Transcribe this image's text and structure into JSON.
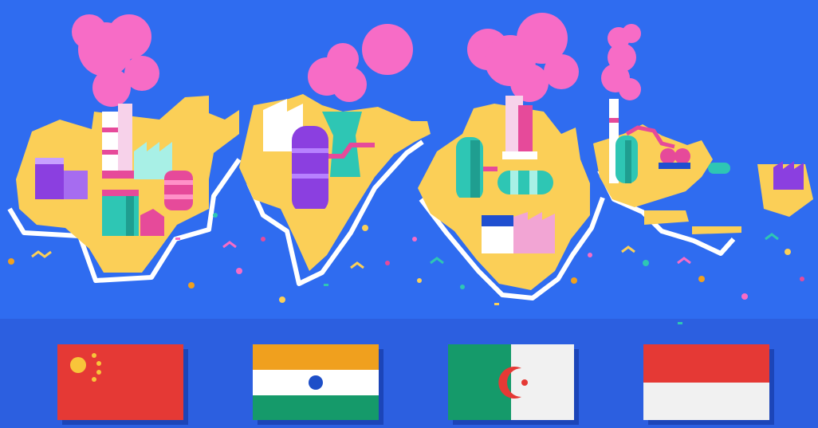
{
  "scene": {
    "colors": {
      "background": "#2f6cf0",
      "bottom_band": "#2c5fe0",
      "land": "#fbcf57",
      "smoke": "#f76cc6",
      "factory_pink": "#e64a9a",
      "factory_teal": "#2ec6b4",
      "factory_purple": "#8b3fe0",
      "coast_line": "#ffffff"
    },
    "countries": [
      {
        "name": "china",
        "flag_colors": [
          "#e53935",
          "#f8c53a"
        ],
        "icon": "china-flag-icon"
      },
      {
        "name": "india",
        "flag_colors": [
          "#f0a01e",
          "#ffffff",
          "#159a6a",
          "#1e4fc8"
        ],
        "icon": "india-flag-icon"
      },
      {
        "name": "algeria",
        "flag_colors": [
          "#159a6a",
          "#ffffff",
          "#e53935"
        ],
        "icon": "algeria-flag-icon"
      },
      {
        "name": "indonesia",
        "flag_colors": [
          "#e53935",
          "#ffffff"
        ],
        "icon": "indonesia-flag-icon"
      }
    ]
  }
}
